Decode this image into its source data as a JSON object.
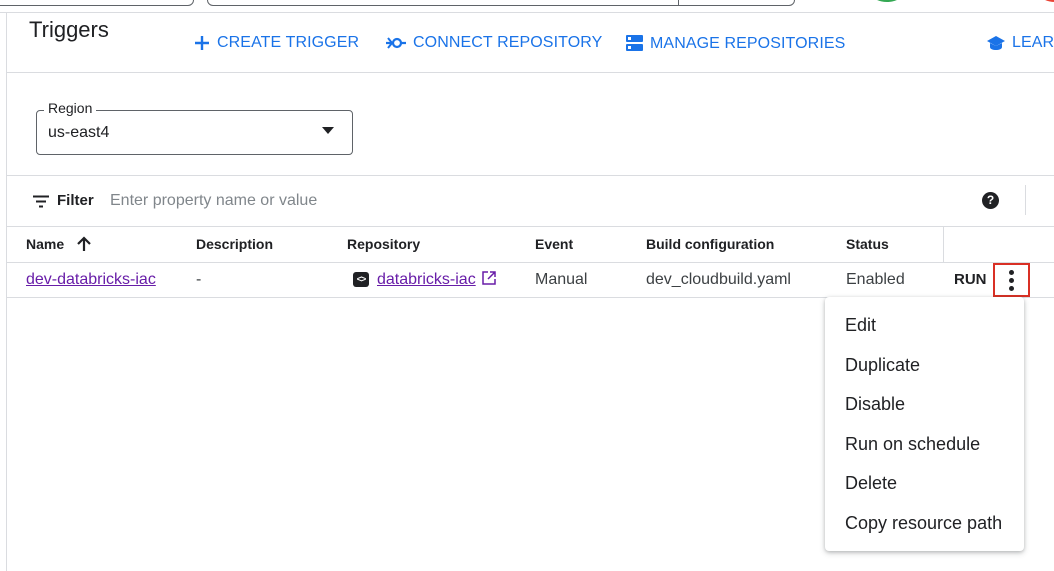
{
  "header": {
    "title": "Triggers",
    "actions": [
      {
        "label": "CREATE TRIGGER",
        "icon": "plus-icon"
      },
      {
        "label": "CONNECT REPOSITORY",
        "icon": "connect-icon"
      },
      {
        "label": "MANAGE REPOSITORIES",
        "icon": "repositories-icon"
      },
      {
        "label": "LEARN",
        "icon": "school-icon"
      }
    ]
  },
  "region": {
    "label": "Region",
    "value": "us-east4"
  },
  "filter": {
    "label": "Filter",
    "placeholder": "Enter property name or value",
    "help_icon": "help-icon"
  },
  "table": {
    "headers": [
      "Name",
      "Description",
      "Repository",
      "Event",
      "Build configuration",
      "Status"
    ],
    "sort": {
      "column": "Name",
      "direction": "ascending"
    },
    "rows": [
      {
        "name": "dev-databricks-iac",
        "description": "-",
        "repository": "databricks-iac",
        "event": "Manual",
        "build_configuration": "dev_cloudbuild.yaml",
        "status": "Enabled",
        "run_label": "RUN"
      }
    ]
  },
  "menu": {
    "items": [
      "Edit",
      "Duplicate",
      "Disable",
      "Run on schedule",
      "Delete",
      "Copy resource path"
    ]
  },
  "colors": {
    "accent": "#1a73e8",
    "link": "#681da8",
    "highlight_border": "#d93025"
  }
}
